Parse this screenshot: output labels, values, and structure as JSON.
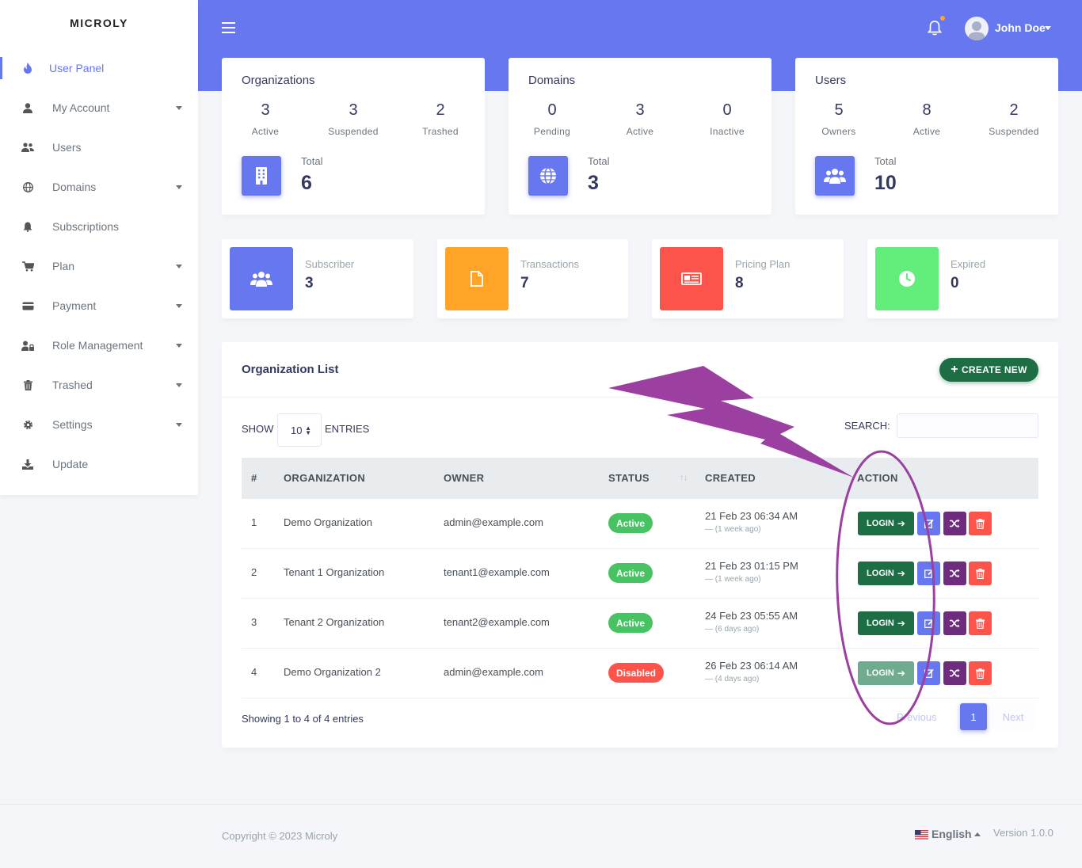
{
  "brand": "MICROLY",
  "sidebar": {
    "items": [
      {
        "label": "User Panel",
        "icon": "fire-icon"
      },
      {
        "label": "My Account",
        "icon": "user-icon"
      },
      {
        "label": "Users",
        "icon": "users-icon"
      },
      {
        "label": "Domains",
        "icon": "globe-icon"
      },
      {
        "label": "Subscriptions",
        "icon": "bell-icon"
      },
      {
        "label": "Plan",
        "icon": "cart-icon"
      },
      {
        "label": "Payment",
        "icon": "credit-card-icon"
      },
      {
        "label": "Role Management",
        "icon": "user-lock-icon"
      },
      {
        "label": "Trashed",
        "icon": "trash-icon"
      },
      {
        "label": "Settings",
        "icon": "gear-icon"
      },
      {
        "label": "Update",
        "icon": "download-icon"
      }
    ]
  },
  "header": {
    "user_name": "John Doe"
  },
  "stats": {
    "organizations": {
      "title": "Organizations",
      "cols": [
        {
          "num": "3",
          "label": "Active"
        },
        {
          "num": "3",
          "label": "Suspended"
        },
        {
          "num": "2",
          "label": "Trashed"
        }
      ],
      "total_label": "Total",
      "total": "6"
    },
    "domains": {
      "title": "Domains",
      "cols": [
        {
          "num": "0",
          "label": "Pending"
        },
        {
          "num": "3",
          "label": "Active"
        },
        {
          "num": "0",
          "label": "Inactive"
        }
      ],
      "total_label": "Total",
      "total": "3"
    },
    "users": {
      "title": "Users",
      "cols": [
        {
          "num": "5",
          "label": "Owners"
        },
        {
          "num": "8",
          "label": "Active"
        },
        {
          "num": "2",
          "label": "Suspended"
        }
      ],
      "total_label": "Total",
      "total": "10"
    }
  },
  "mini_stats": [
    {
      "title": "Subscriber",
      "value": "3",
      "color": "#6777ef"
    },
    {
      "title": "Transactions",
      "value": "7",
      "color": "#ffa426"
    },
    {
      "title": "Pricing Plan",
      "value": "8",
      "color": "#fc544b"
    },
    {
      "title": "Expired",
      "value": "0",
      "color": "#63ed7a"
    }
  ],
  "org_list": {
    "title": "Organization List",
    "create_label": "CREATE NEW",
    "show_label": "SHOW",
    "entries_value": "10",
    "entries_label": "ENTRIES",
    "search_label": "SEARCH:",
    "columns": [
      "#",
      "ORGANIZATION",
      "OWNER",
      "STATUS",
      "CREATED",
      "ACTION"
    ],
    "rows": [
      {
        "num": "1",
        "org": "Demo Organization",
        "owner": "admin@example.com",
        "status": "Active",
        "created": "21 Feb 23 06:34 AM",
        "rel": "— (1 week ago)"
      },
      {
        "num": "2",
        "org": "Tenant 1 Organization",
        "owner": "tenant1@example.com",
        "status": "Active",
        "created": "21 Feb 23 01:15 PM",
        "rel": "— (1 week ago)"
      },
      {
        "num": "3",
        "org": "Tenant 2 Organization",
        "owner": "tenant2@example.com",
        "status": "Active",
        "created": "24 Feb 23 05:55 AM",
        "rel": "— (6 days ago)"
      },
      {
        "num": "4",
        "org": "Demo Organization 2",
        "owner": "admin@example.com",
        "status": "Disabled",
        "created": "26 Feb 23 06:14 AM",
        "rel": "— (4 days ago)"
      }
    ],
    "login_label": "LOGIN",
    "info": "Showing 1 to 4 of 4 entries",
    "prev_label": "Previous",
    "current_page": "1",
    "next_label": "Next"
  },
  "footer": {
    "copyright": "Copyright © 2023 Microly",
    "language": "English",
    "version": "Version 1.0.0"
  },
  "colors": {
    "primary": "#6777ef",
    "success": "#47c363",
    "danger": "#fc544b",
    "login_green": "#1d6e45",
    "shuffle_purple": "#6f2c7e",
    "annotation": "#9b3fa0"
  }
}
